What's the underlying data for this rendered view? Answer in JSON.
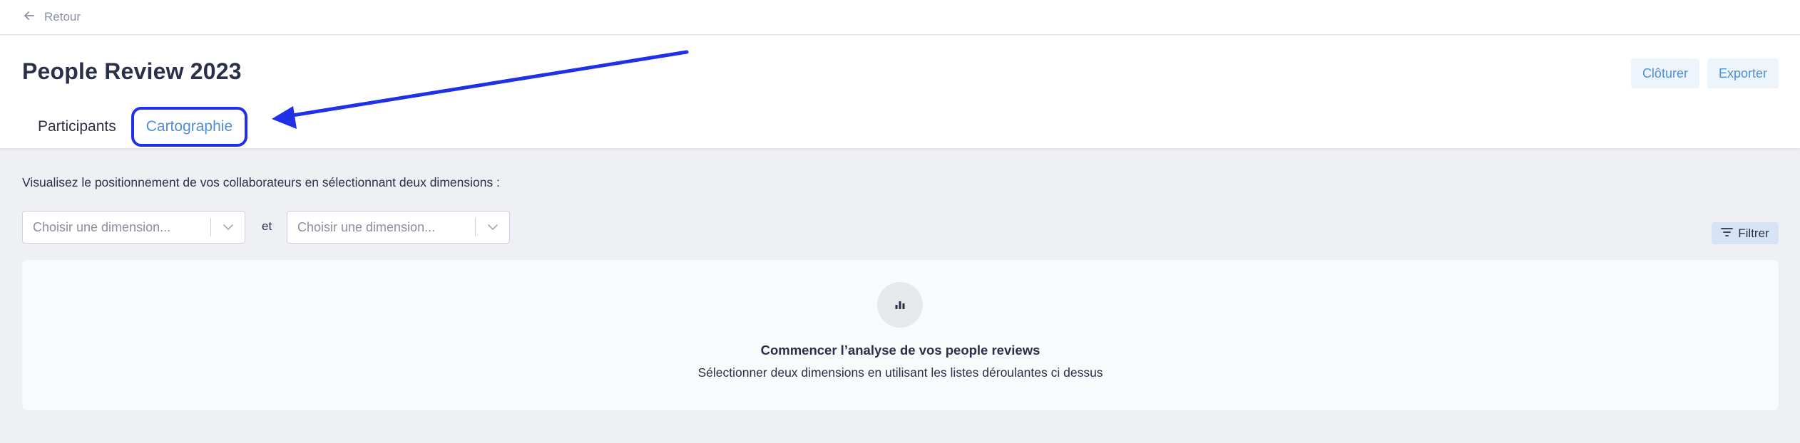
{
  "topbar": {
    "back_label": "Retour"
  },
  "header": {
    "title": "People Review 2023",
    "actions": {
      "close_label": "Clôturer",
      "export_label": "Exporter"
    },
    "tabs": [
      {
        "label": "Participants",
        "active": false
      },
      {
        "label": "Cartographie",
        "active": true
      }
    ]
  },
  "cartography": {
    "intro": "Visualisez le positionnement de vos collaborateurs en sélectionnant deux dimensions :",
    "dimension_1": {
      "placeholder": "Choisir une dimension..."
    },
    "connector": "et",
    "dimension_2": {
      "placeholder": "Choisir une dimension..."
    },
    "filter_label": "Filtrer",
    "empty_state": {
      "icon": "bar-chart-icon",
      "title": "Commencer l’analyse de vos people reviews",
      "subtitle": "Sélectionner deux dimensions en utilisant les listes déroulantes ci dessus"
    }
  },
  "colors": {
    "accent": "#4f8fda",
    "annotation": "#1f30e8",
    "text": "#2b2f48",
    "muted": "#8b8fa3",
    "background": "#eff0f4"
  }
}
